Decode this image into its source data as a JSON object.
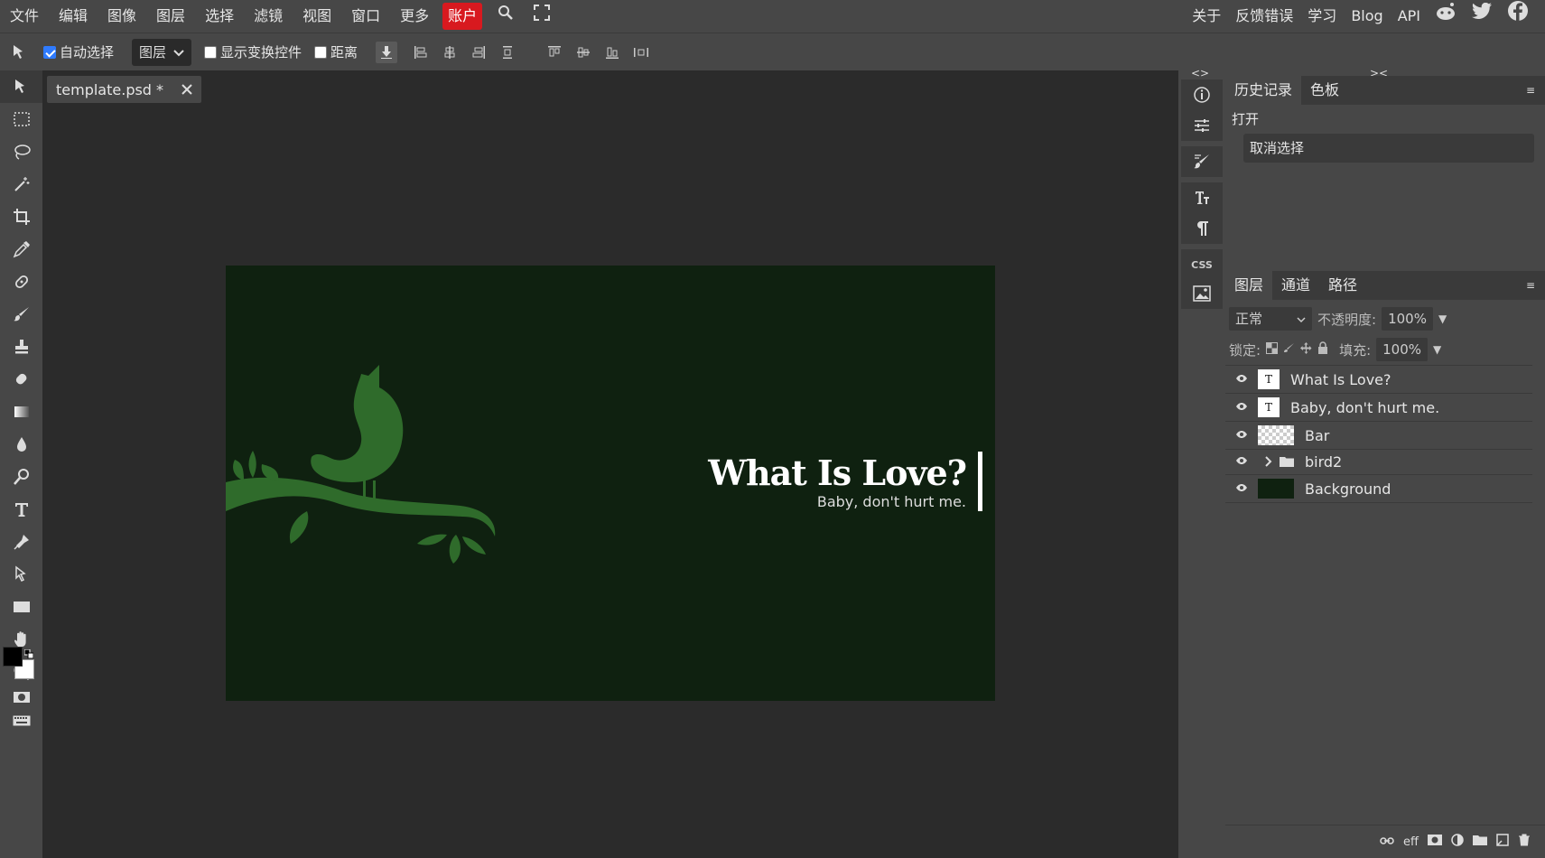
{
  "menu": {
    "items": [
      "文件",
      "编辑",
      "图像",
      "图层",
      "选择",
      "滤镜",
      "视图",
      "窗口",
      "更多"
    ],
    "account": "账户",
    "right_items": [
      "关于",
      "反馈错误",
      "学习",
      "Blog",
      "API"
    ]
  },
  "options": {
    "auto_select_label": "自动选择",
    "auto_select_checked": true,
    "select_value": "图层",
    "show_transform_label": "显示变换控件",
    "distance_label": "距离"
  },
  "document": {
    "tab_title": "template.psd *",
    "title_text": "What Is Love?",
    "subtitle_text": "Baby, don't hurt me.",
    "bg_color": "#0f2110",
    "bird_color": "#2f6b2b"
  },
  "history_panel": {
    "tabs": [
      "历史记录",
      "色板"
    ],
    "rows": [
      "打开",
      "取消选择"
    ]
  },
  "layers_panel": {
    "tabs": [
      "图层",
      "通道",
      "路径"
    ],
    "blend_mode": "正常",
    "opacity_label": "不透明度:",
    "opacity_value": "100%",
    "lock_label": "锁定:",
    "fill_label": "填充:",
    "fill_value": "100%",
    "layers": [
      {
        "name": "What Is Love?",
        "kind": "text"
      },
      {
        "name": "Baby, don't hurt me.",
        "kind": "text"
      },
      {
        "name": "Bar",
        "kind": "raster"
      },
      {
        "name": "bird2",
        "kind": "folder"
      },
      {
        "name": "Background",
        "kind": "raster"
      }
    ]
  },
  "mini_panel": {
    "css_label": "CSS"
  }
}
